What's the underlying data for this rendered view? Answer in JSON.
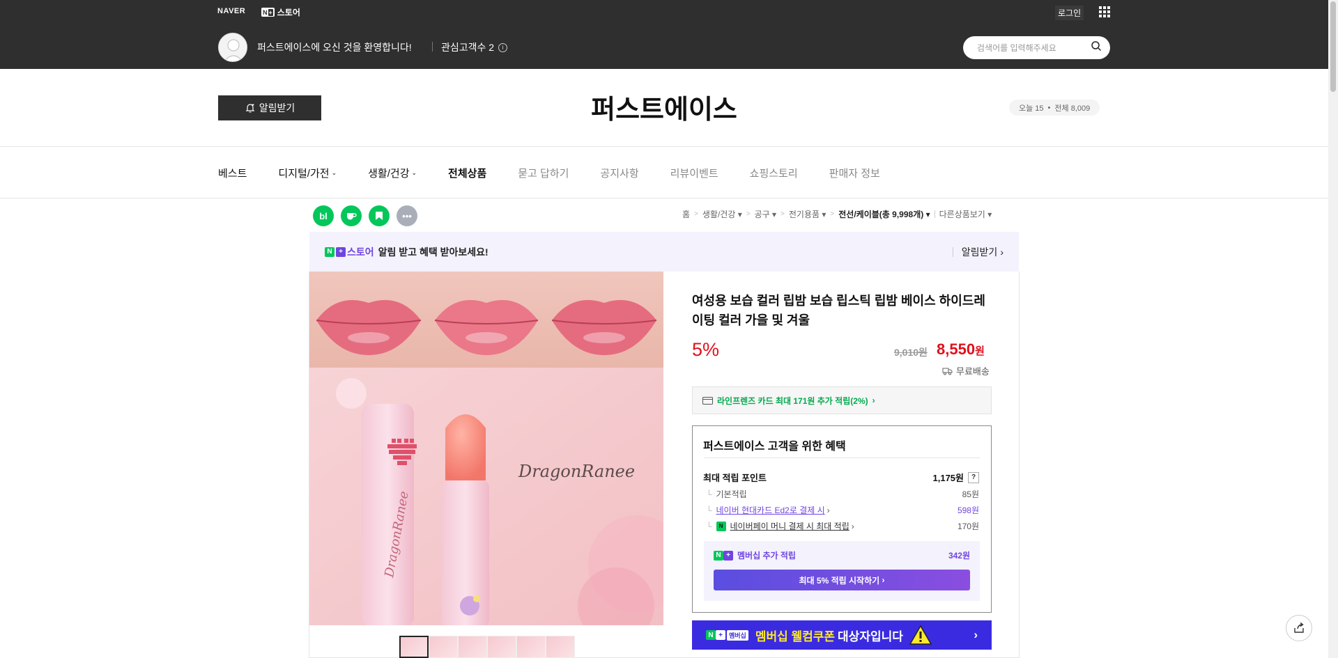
{
  "top": {
    "naver": "NAVER",
    "npstore": "스토어",
    "login": "로그인",
    "welcome": "퍼스트에이스에 오신 것을 환영합니다!",
    "interest": "관심고객수 2",
    "search_placeholder": "검색어를 입력해주세요"
  },
  "store": {
    "alarm": "알림받기",
    "title": "퍼스트에이스",
    "visits_today": "오늘 15",
    "visits_total": "전체 8,009"
  },
  "nav": {
    "items": [
      "베스트",
      "디지털/가전",
      "생활/건강",
      "전체상품",
      "묻고 답하기",
      "공지사항",
      "리뷰이벤트",
      "쇼핑스토리",
      "판매자 정보"
    ]
  },
  "breadcrumbs": {
    "home": "홈",
    "c1": "생활/건강",
    "c2": "공구",
    "c3": "전기용품",
    "c4": "전선/케이블(총 9,998개)",
    "other": "다른상품보기"
  },
  "npbanner": {
    "brand": "스토어",
    "text": "알림 받고 혜택 받아보세요!",
    "right": "알림받기"
  },
  "product": {
    "title": "여성용 보습 컬러 립밤 보습 립스틱 립밤 베이스 하이드레이팅 컬러 가을 및 겨울",
    "discount": "5%",
    "old_price": "9,010원",
    "price": "8,550",
    "price_unit": "원",
    "shipping": "무료배송",
    "card_benefit": "라인프렌즈 카드 최대 171원 추가 적립(2%)",
    "brand_text": "DragonRanee"
  },
  "benefit": {
    "title": "퍼스트에이스 고객을 위한 혜택",
    "max_label": "최대 적립 포인트",
    "max_val": "1,175원",
    "basic_label": "기본적립",
    "basic_val": "85원",
    "card_label": "네이버 현대카드 Ed2로 결제 시",
    "card_val": "598원",
    "pay_label": "네이버페이 머니 결제 시 최대 적립",
    "pay_val": "170원",
    "member_label": "멤버십 추가 적립",
    "member_val": "342원",
    "member_btn": "최대 5% 적립 시작하기"
  },
  "coupon": {
    "pre": "멤버십",
    "highlight": "멤버십 웰컴쿠폰",
    "post": "대상자입니다"
  },
  "colors": {
    "accent_red": "#e0101d",
    "naver_green": "#03c75a",
    "membership_purple": "#6f45e0",
    "coupon_blue": "#3b2be0"
  }
}
